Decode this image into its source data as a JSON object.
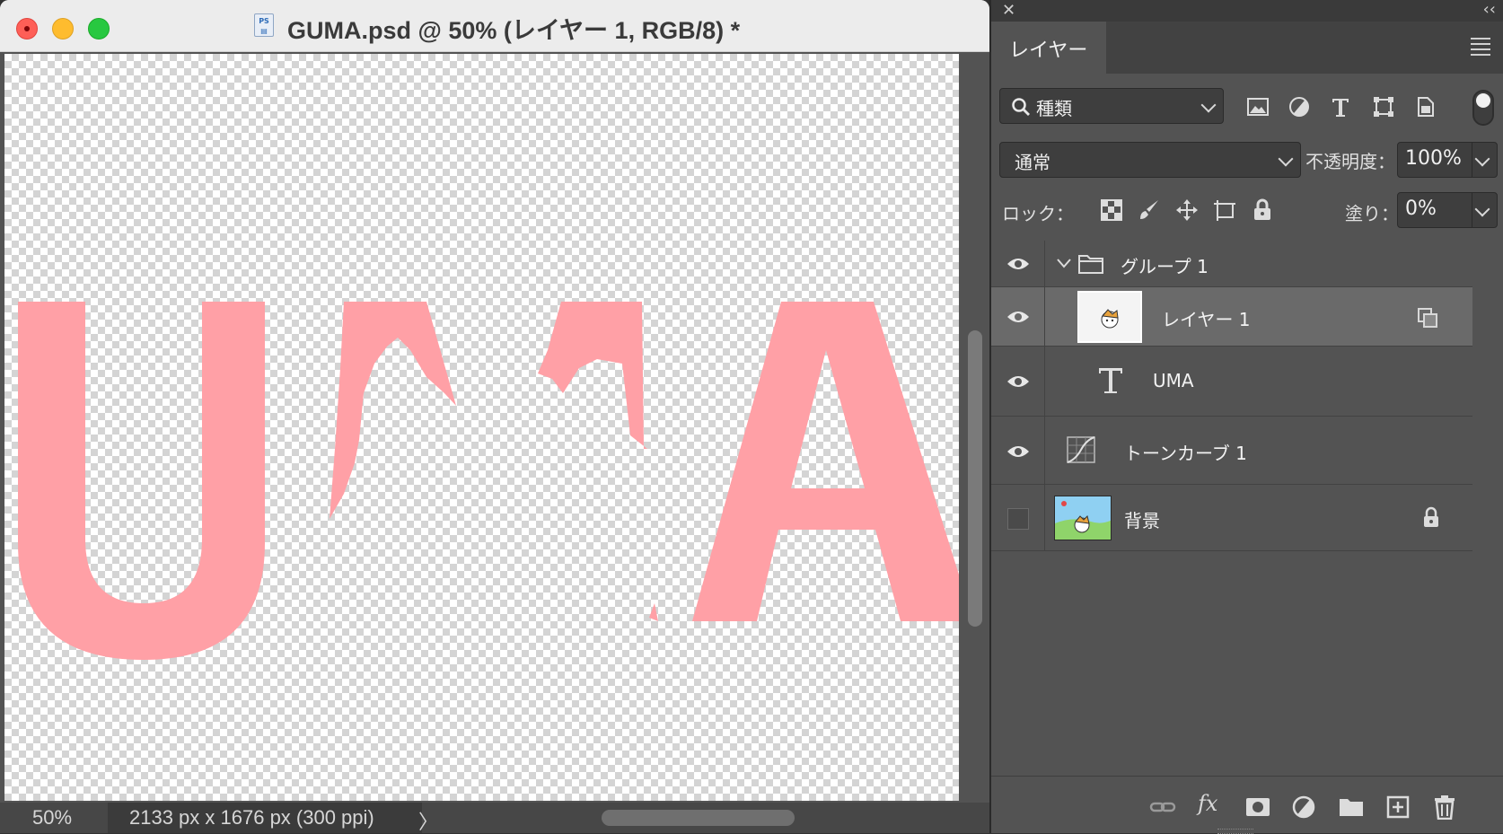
{
  "document": {
    "icon_label": "PS\nPSD",
    "title": "GUMA.psd @ 50% (レイヤー 1, RGB/8) *",
    "canvas_text": "UMA",
    "text_color": "#ffa0a6"
  },
  "status": {
    "zoom": "50%",
    "doc_size": "2133 px x 1676 px (300 ppi)",
    "arrow": "〉"
  },
  "panel": {
    "tab_label": "レイヤー",
    "filter": {
      "label": "種類"
    },
    "filter_icons": [
      "image-filter-icon",
      "adjustment-filter-icon",
      "type-filter-icon",
      "shape-filter-icon",
      "smart-object-filter-icon"
    ],
    "blend_mode": "通常",
    "opacity_label": "不透明度：",
    "opacity_value": "100%",
    "lock_label": "ロック：",
    "lock_icons": [
      "lock-transparent-pixels-icon",
      "lock-image-pixels-icon",
      "lock-position-icon",
      "lock-artboard-icon",
      "lock-all-icon"
    ],
    "fill_label": "塗り：",
    "fill_value": "0%",
    "layers": [
      {
        "name": "グループ 1",
        "type": "group",
        "visible": true,
        "expanded": true
      },
      {
        "name": "レイヤー 1",
        "type": "pixel",
        "visible": true,
        "selected": true,
        "clipped": true
      },
      {
        "name": "UMA",
        "type": "text",
        "visible": true
      },
      {
        "name": "トーンカーブ 1",
        "type": "adjustment",
        "visible": true
      },
      {
        "name": "背景",
        "type": "background",
        "visible": false,
        "locked": true
      }
    ],
    "footer_icons": [
      "link-layers-icon",
      "layer-style-fx-icon",
      "add-mask-icon",
      "new-adjustment-layer-icon",
      "new-group-icon",
      "new-layer-icon",
      "delete-layer-icon"
    ],
    "fx_label": "fx"
  },
  "colors": {
    "panel_bg": "#535353",
    "selected_row": "#6a6a6a",
    "pink": "#ffa0a6"
  }
}
